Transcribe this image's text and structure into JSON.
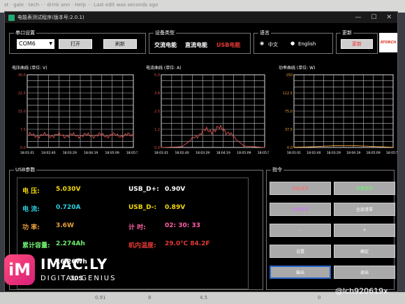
{
  "background": {
    "top_text": "st · gale · tech · · drink ann · Help · · Last edit was seconds ago",
    "bottom": {
      "v1": "0.91",
      "v2": "8",
      "v3": "4.5",
      "v4": "0"
    }
  },
  "window": {
    "title": "电能表测试程序(版本号:2.0.1)",
    "minimize_icon": "—",
    "maximize_icon": "☐",
    "close_icon": "✕"
  },
  "serial": {
    "title": "串口设置",
    "port": "COM6",
    "open": "打开",
    "refresh": "刷新"
  },
  "device": {
    "title": "设备类型",
    "ac": "交流电能",
    "dc": "直流电能",
    "usb": "USB电能"
  },
  "language": {
    "title": "语言",
    "zh": "中文",
    "en": "English",
    "selected": "zh"
  },
  "update": {
    "title": "更新",
    "button": "更新",
    "logo": "ATORCH"
  },
  "charts": [
    {
      "title": "电压曲线 (单位: V)",
      "color": "#d9534f",
      "yticks": [
        "30.0",
        "22.5",
        "15.0",
        "7.5",
        "0.0"
      ],
      "xticks": [
        "18:01:01",
        "18:02:40",
        "18:03:29",
        "18:04:19",
        "18:05:09",
        "18:05:59"
      ]
    },
    {
      "title": "电流曲线 (单位: A)",
      "color": "#d9534f",
      "yticks": [
        "5.0",
        "3.8",
        "2.5",
        "1.2",
        "0.0"
      ],
      "xticks": [
        "18:01:01",
        "18:02:40",
        "18:03:29",
        "18:04:19",
        "18:05:09",
        "18:05:59"
      ]
    },
    {
      "title": "功率曲线 (单位: W)",
      "color": "#e8a23a",
      "yticks": [
        "150",
        "112.5",
        "75.0",
        "37.5",
        "0.0"
      ],
      "xticks": [
        "18:01:01",
        "18:02:40",
        "18:03:29",
        "18:04:19",
        "18:05:09",
        "18:05:59"
      ]
    }
  ],
  "chart_data": [
    {
      "type": "line",
      "title": "电压曲线 (单位: V)",
      "ylim": [
        0,
        30
      ],
      "x": [
        "18:01:01",
        "18:02:40",
        "18:03:29",
        "18:04:19",
        "18:05:09",
        "18:05:59"
      ],
      "series": [
        {
          "values": [
            5.0,
            5.0,
            5.0,
            5.0,
            5.0,
            5.0
          ]
        }
      ]
    },
    {
      "type": "line",
      "title": "电流曲线 (单位: A)",
      "ylim": [
        0,
        5
      ],
      "x": [
        "18:01:01",
        "18:02:40",
        "18:03:29",
        "18:04:19",
        "18:05:09",
        "18:05:59"
      ],
      "series": [
        {
          "values": [
            0.0,
            0.05,
            1.1,
            1.3,
            0.1,
            0.0
          ]
        }
      ]
    },
    {
      "type": "line",
      "title": "功率曲线 (单位: W)",
      "ylim": [
        0,
        150
      ],
      "x": [
        "18:01:01",
        "18:02:40",
        "18:03:29",
        "18:04:19",
        "18:05:09",
        "18:05:59"
      ],
      "series": [
        {
          "values": [
            0.5,
            1.5,
            3.6,
            3.8,
            2.0,
            0.5
          ]
        }
      ]
    }
  ],
  "usb": {
    "title": "USB参数",
    "voltage_label": "电    压:",
    "voltage": "5.030V",
    "current_label": "电    流:",
    "current": "0.720A",
    "power_label": "功    率:",
    "power": "3.6W",
    "capacity_label": "累计容量:",
    "capacity": "2.274Ah",
    "energy": "16.26Wh",
    "partial": "30S",
    "dplus_label": "USB_D+:",
    "dplus": "0.90V",
    "dminus_label": "USB_D-:",
    "dminus": "0.89V",
    "timer_label": "计    时:",
    "timer": "02: 30: 33",
    "temp_label": "机内温度:",
    "temp": "29.0℃ 84.2F"
  },
  "commands": {
    "title": "指令",
    "b1": "电能清零",
    "b2": "容量清零",
    "b3": "时间清零",
    "b4": "全部清零",
    "b5": "-",
    "b6": "+",
    "b7": "设置",
    "b8": "确定",
    "b9": "输出",
    "b10": "退出"
  },
  "watermark": {
    "logo": "iM",
    "brand": "IMAC.LY",
    "sub": "DIGITAL GENIUS",
    "user": "@lch920619x"
  },
  "colors": {
    "accent_red": "#e53935",
    "yellow": "#f5d90a",
    "cyan": "#2ad1e0",
    "pink": "#ff5fa8",
    "purple": "#c98cff",
    "green": "#6ff06f",
    "grid": "#bdbdbd"
  }
}
